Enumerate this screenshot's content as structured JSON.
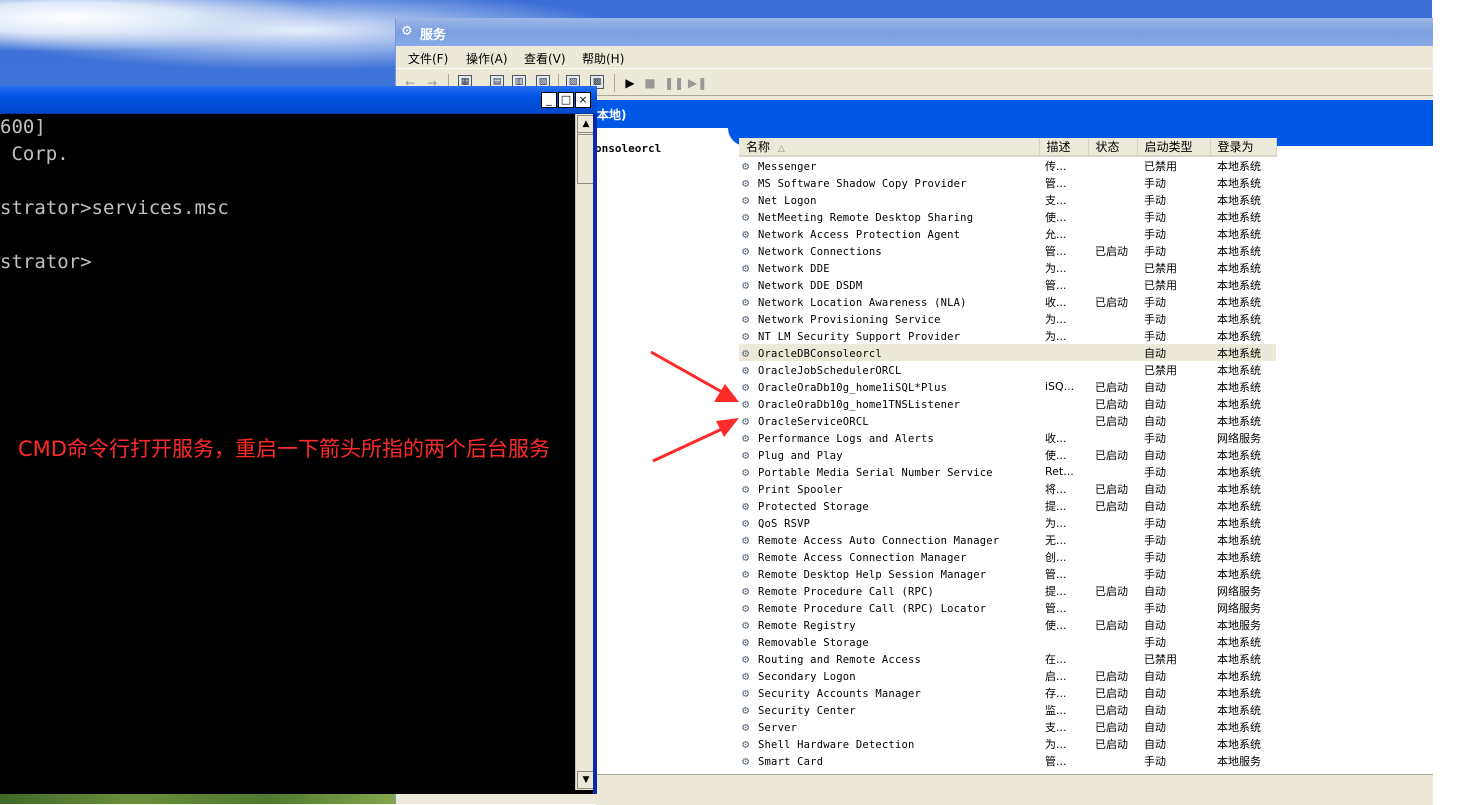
{
  "services_window": {
    "title": "服务",
    "menu": [
      "文件(F)",
      "操作(A)",
      "查看(V)",
      "帮助(H)"
    ],
    "banner_text": "本地)",
    "left_pane_text": "onsoleorcl",
    "columns": [
      "名称",
      "描述",
      "状态",
      "启动类型",
      "登录为"
    ],
    "sort_indicator": "△",
    "rows": [
      {
        "name": "Messenger",
        "desc": "传...",
        "status": "",
        "startup": "已禁用",
        "logon": "本地系统"
      },
      {
        "name": "MS Software Shadow Copy Provider",
        "desc": "管...",
        "status": "",
        "startup": "手动",
        "logon": "本地系统"
      },
      {
        "name": "Net Logon",
        "desc": "支...",
        "status": "",
        "startup": "手动",
        "logon": "本地系统"
      },
      {
        "name": "NetMeeting Remote Desktop Sharing",
        "desc": "使...",
        "status": "",
        "startup": "手动",
        "logon": "本地系统"
      },
      {
        "name": "Network Access Protection Agent",
        "desc": "允...",
        "status": "",
        "startup": "手动",
        "logon": "本地系统"
      },
      {
        "name": "Network Connections",
        "desc": "管...",
        "status": "已启动",
        "startup": "手动",
        "logon": "本地系统"
      },
      {
        "name": "Network DDE",
        "desc": "为...",
        "status": "",
        "startup": "已禁用",
        "logon": "本地系统"
      },
      {
        "name": "Network DDE DSDM",
        "desc": "管...",
        "status": "",
        "startup": "已禁用",
        "logon": "本地系统"
      },
      {
        "name": "Network Location Awareness (NLA)",
        "desc": "收...",
        "status": "已启动",
        "startup": "手动",
        "logon": "本地系统"
      },
      {
        "name": "Network Provisioning Service",
        "desc": "为...",
        "status": "",
        "startup": "手动",
        "logon": "本地系统"
      },
      {
        "name": "NT LM Security Support Provider",
        "desc": "为...",
        "status": "",
        "startup": "手动",
        "logon": "本地系统"
      },
      {
        "name": "OracleDBConsoleorcl",
        "desc": "",
        "status": "",
        "startup": "自动",
        "logon": "本地系统",
        "selected": true
      },
      {
        "name": "OracleJobSchedulerORCL",
        "desc": "",
        "status": "",
        "startup": "已禁用",
        "logon": "本地系统"
      },
      {
        "name": "OracleOraDb10g_home1iSQL*Plus",
        "desc": "iSQ...",
        "status": "已启动",
        "startup": "自动",
        "logon": "本地系统"
      },
      {
        "name": "OracleOraDb10g_home1TNSListener",
        "desc": "",
        "status": "已启动",
        "startup": "自动",
        "logon": "本地系统"
      },
      {
        "name": "OracleServiceORCL",
        "desc": "",
        "status": "已启动",
        "startup": "自动",
        "logon": "本地系统"
      },
      {
        "name": "Performance Logs and Alerts",
        "desc": "收...",
        "status": "",
        "startup": "手动",
        "logon": "网络服务"
      },
      {
        "name": "Plug and Play",
        "desc": "使...",
        "status": "已启动",
        "startup": "自动",
        "logon": "本地系统"
      },
      {
        "name": "Portable Media Serial Number Service",
        "desc": "Ret...",
        "status": "",
        "startup": "手动",
        "logon": "本地系统"
      },
      {
        "name": "Print Spooler",
        "desc": "将...",
        "status": "已启动",
        "startup": "自动",
        "logon": "本地系统"
      },
      {
        "name": "Protected Storage",
        "desc": "提...",
        "status": "已启动",
        "startup": "自动",
        "logon": "本地系统"
      },
      {
        "name": "QoS RSVP",
        "desc": "为...",
        "status": "",
        "startup": "手动",
        "logon": "本地系统"
      },
      {
        "name": "Remote Access Auto Connection Manager",
        "desc": "无...",
        "status": "",
        "startup": "手动",
        "logon": "本地系统"
      },
      {
        "name": "Remote Access Connection Manager",
        "desc": "创...",
        "status": "",
        "startup": "手动",
        "logon": "本地系统"
      },
      {
        "name": "Remote Desktop Help Session Manager",
        "desc": "管...",
        "status": "",
        "startup": "手动",
        "logon": "本地系统"
      },
      {
        "name": "Remote Procedure Call (RPC)",
        "desc": "提...",
        "status": "已启动",
        "startup": "自动",
        "logon": "网络服务"
      },
      {
        "name": "Remote Procedure Call (RPC) Locator",
        "desc": "管...",
        "status": "",
        "startup": "手动",
        "logon": "网络服务"
      },
      {
        "name": "Remote Registry",
        "desc": "使...",
        "status": "已启动",
        "startup": "自动",
        "logon": "本地服务"
      },
      {
        "name": "Removable Storage",
        "desc": "",
        "status": "",
        "startup": "手动",
        "logon": "本地系统"
      },
      {
        "name": "Routing and Remote Access",
        "desc": "在...",
        "status": "",
        "startup": "已禁用",
        "logon": "本地系统"
      },
      {
        "name": "Secondary Logon",
        "desc": "启...",
        "status": "已启动",
        "startup": "自动",
        "logon": "本地系统"
      },
      {
        "name": "Security Accounts Manager",
        "desc": "存...",
        "status": "已启动",
        "startup": "自动",
        "logon": "本地系统"
      },
      {
        "name": "Security Center",
        "desc": "监...",
        "status": "已启动",
        "startup": "自动",
        "logon": "本地系统"
      },
      {
        "name": "Server",
        "desc": "支...",
        "status": "已启动",
        "startup": "自动",
        "logon": "本地系统"
      },
      {
        "name": "Shell Hardware Detection",
        "desc": "为...",
        "status": "已启动",
        "startup": "自动",
        "logon": "本地系统"
      },
      {
        "name": "Smart Card",
        "desc": "管...",
        "status": "",
        "startup": "手动",
        "logon": "本地服务"
      }
    ]
  },
  "cmd_window": {
    "buttons": [
      "_",
      "□",
      "×"
    ],
    "lines": [
      "600]",
      " Corp.",
      "",
      "strator>services.msc",
      "",
      "strator>"
    ]
  },
  "annotation": {
    "text": "CMD命令行打开服务，重启一下箭头所指的两个后台服务",
    "color": "#ff2a2a"
  },
  "colors": {
    "xp_blue": "#0058e6",
    "selection": "#ece9d8"
  }
}
